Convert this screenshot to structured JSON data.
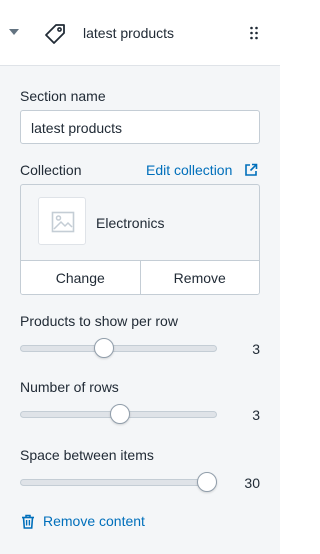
{
  "header": {
    "title": "latest products",
    "icons": {
      "caret": "caret-down-icon",
      "section": "tag-icon",
      "drag": "drag-handle-icon"
    }
  },
  "section_name": {
    "label": "Section name",
    "value": "latest products"
  },
  "collection": {
    "label": "Collection",
    "edit_link": "Edit collection",
    "selected": "Electronics",
    "change_label": "Change",
    "remove_label": "Remove"
  },
  "sliders": [
    {
      "label": "Products to show per row",
      "value": "3",
      "fraction": 0.42
    },
    {
      "label": "Number of rows",
      "value": "3",
      "fraction": 0.51
    },
    {
      "label": "Space between items",
      "value": "30",
      "fraction": 1.0
    }
  ],
  "footer": {
    "remove_content": "Remove content"
  },
  "colors": {
    "link": "#006fbb",
    "text": "#212b36",
    "background": "#f4f6f8",
    "border": "#c4cdd5"
  }
}
